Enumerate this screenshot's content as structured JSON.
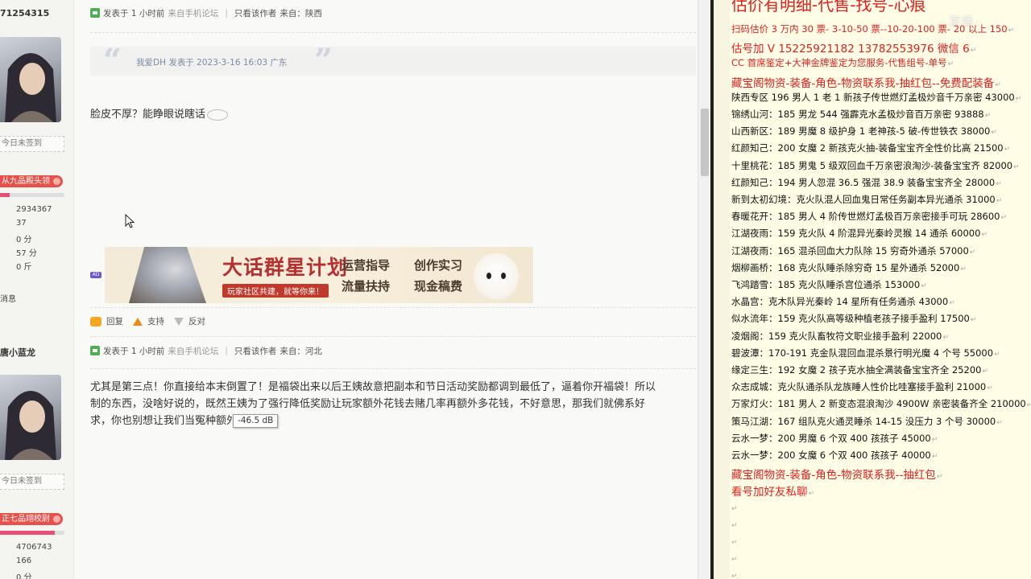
{
  "forum": {
    "users": [
      {
        "id_text": "71254315",
        "signin": "今日未签到",
        "rank": "从九品殿头领",
        "level_fill": 0.15,
        "stats": [
          "2934367",
          "37",
          "0 分",
          "57 分",
          "0 斤"
        ],
        "messages_label": "消息"
      },
      {
        "id_text": "唐小蓝龙",
        "signin": "今日未签到",
        "rank": "正七品翊校尉",
        "level_fill": 0.85,
        "stats": [
          "4706743",
          "166",
          "0 分"
        ]
      }
    ],
    "posts": [
      {
        "meta": {
          "posted": "发表于 1 小时前",
          "source": "来自手机论坛",
          "only_author": "只看该作者",
          "from": "来自：陕西"
        },
        "quote": {
          "text": "我爱DH 发表于 2023-3-16 16:03 广东"
        },
        "body": "脸皮不厚？能睁眼说瞎话"
      },
      {
        "meta": {
          "posted": "发表于 1 小时前",
          "source": "来自手机论坛",
          "only_author": "只看该作者",
          "from": "来自：河北"
        },
        "body_lines": [
          "尤其是第三点！你直接给本末倒置了！是福袋出来以后王姨故意把副本和节日活动奖励都调到最低了，逼着你开福袋！所以",
          "制的东西，没啥好说的，既然王姨为了强行降低奖励让玩家额外花钱去赌几率再额外多花钱，不好意思，那我们就佛系好",
          "求，你也别想让我们当冤种额外花钱！"
        ]
      }
    ],
    "ad": {
      "tag": "AD",
      "title": "大话群星计划",
      "subtitle": "玩家社区共建，就等你来！",
      "tags": [
        "运营指导",
        "创作实习",
        "流量扶持",
        "现金稿费"
      ]
    },
    "actions": {
      "reply": "回复",
      "support": "支持",
      "oppose": "反对"
    },
    "tooltip": "-46.5 dB"
  },
  "sheet": {
    "headline": "估价有明细-代售-找号-心痕",
    "watermark": "直播",
    "lines": [
      {
        "text": "扫码估价 3 万内 30 票- 3-10-50 票--10-20-100 票- 20 以上 150",
        "style": "red"
      },
      {
        "text": "估号加 V 15225921182   13782553976   微信 6",
        "style": "red-big"
      },
      {
        "text": "CC 首席鉴定+大神金牌鉴定为您服务-代售组号-单号",
        "style": "red"
      },
      {
        "text": "藏宝阁物资-装备-角色-物资联系我-抽红包--免费配装备",
        "style": "red-big"
      },
      {
        "text": "陕西专区 196 男人 1 老 1 新孩子传世燃灯孟极炒音千万亲密 43000",
        "style": ""
      },
      {
        "text": "锦绣山河：185 男龙 544 强霹克水孟极炒音百万亲密 93888",
        "style": ""
      },
      {
        "text": "山西新区：189 男魔 8 级护身 1 老神孩-5 破-传世铁衣 38000",
        "style": ""
      },
      {
        "text": "红颜知己：200 女魔 2 新孩克火抽-装备宝宝齐全性价比高 21500",
        "style": ""
      },
      {
        "text": "十里桃花：185 男鬼 5 级双回血千万亲密浪淘沙-装备宝宝齐 82000",
        "style": ""
      },
      {
        "text": "红颜知己：194 男人忽混 36.5 强混 38.9 装备宝宝齐全 28000",
        "style": ""
      },
      {
        "text": "新到太初幻境：克火队混人回血鬼日常任务副本异光通杀 31000",
        "style": ""
      },
      {
        "text": "春暖花开：185 男人 4 阶传世燃灯孟极百万亲密接手可玩 28600",
        "style": ""
      },
      {
        "text": "江湖夜雨：159 克火队 4 阶混异光秦岭灵猴 14 通杀 60000",
        "style": ""
      },
      {
        "text": "江湖夜雨：165 混杀回血大力队除 15 穷奇外通杀 57000",
        "style": ""
      },
      {
        "text": "烟柳画桥：168 克火队睡杀除穷奇 15 星外通杀 52000",
        "style": ""
      },
      {
        "text": "飞鸿踏雪：185 克火队睡杀宫位通杀 153000",
        "style": ""
      },
      {
        "text": "水晶宫：克木队异光秦岭 14 星所有任务通杀 43000",
        "style": ""
      },
      {
        "text": "似水流年：159 克火队高等级种植老孩子接手盈利 17500",
        "style": ""
      },
      {
        "text": "凌烟阁：159 克火队畜牧符文职业接手盈利 22000",
        "style": ""
      },
      {
        "text": "碧波潭：170-191 克金队混回血混杀景行明光魔 4 个号 55000",
        "style": ""
      },
      {
        "text": "缘定三生：192 女魔 2 孩子克水抽全满装备宝宝齐全 25200",
        "style": ""
      },
      {
        "text": "众志成城：克火队通杀队龙族睡人性价比哇塞接手盈利 21000",
        "style": ""
      },
      {
        "text": "万家灯火：181 男人 2 新变态混浪淘沙 4900W 亲密装备齐全 210000",
        "style": ""
      },
      {
        "text": "策马江湖：167 组队克火通灵睡杀 14-15 没压力 3 个号 30000",
        "style": ""
      },
      {
        "text": "云水一梦：200 男魔 6 个双 400 孩孩子 45000",
        "style": ""
      },
      {
        "text": "云水一梦：200 女魔 6 个双 400 孩孩子 40000",
        "style": ""
      },
      {
        "text": "藏宝阁物资-装备-角色-物资联系我--抽红包",
        "style": "red-big"
      },
      {
        "text": "看号加好友私聊",
        "style": "red-big"
      }
    ],
    "paragraph_mark": "↵",
    "colors": {
      "accent_red": "#e02020",
      "sheet_bg": "#fffde6"
    }
  }
}
